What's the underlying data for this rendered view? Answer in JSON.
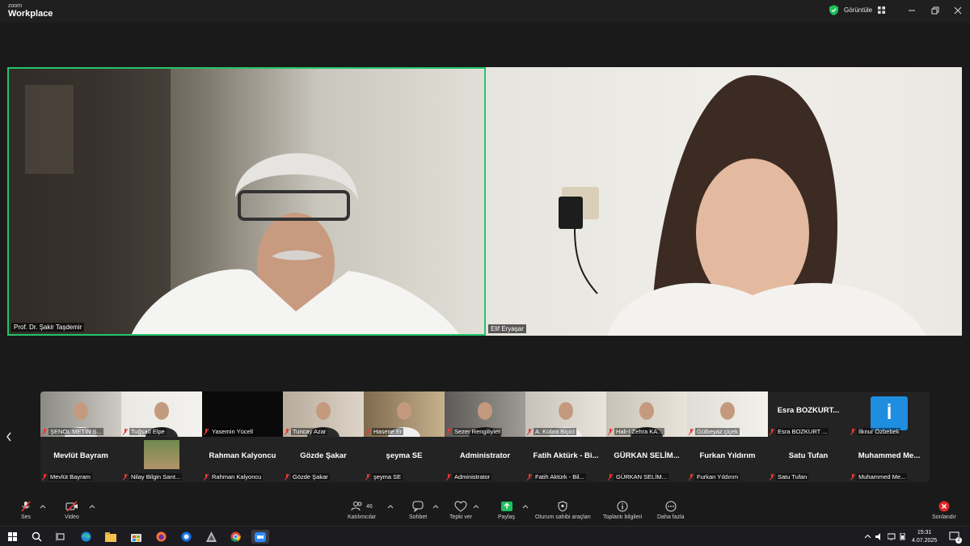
{
  "app": {
    "brand_small": "zoom",
    "brand_big": "Workplace"
  },
  "titlebar": {
    "view_label": "Görüntüle"
  },
  "main_videos": [
    {
      "name": "Prof. Dr. Şakir Taşdemir"
    },
    {
      "name": "Elif Eryaşar"
    }
  ],
  "gallery": {
    "row1": [
      {
        "label": "ŞENOL METİN S...",
        "type": "video"
      },
      {
        "label": "Tuğşad Elpe",
        "type": "video"
      },
      {
        "label": "Yasemin Yücell",
        "type": "black"
      },
      {
        "label": "Tuncay Azar",
        "type": "video"
      },
      {
        "label": "Hasene Er",
        "type": "video"
      },
      {
        "label": "Sezer Rengiliyler",
        "type": "video"
      },
      {
        "label": "A. Kübra Biçici",
        "type": "video"
      },
      {
        "label": "Hali-I Zehra KA...",
        "type": "video"
      },
      {
        "label": "Gülbeyaz çiçek",
        "type": "video"
      },
      {
        "label": "Esra BOZKURT ...",
        "type": "name",
        "display": "Esra BOZKURT..."
      },
      {
        "label": "İlknur Özbebek",
        "type": "avatar",
        "avatar_letter": "İ"
      }
    ],
    "row2": [
      {
        "label": "Mevlüt Bayram",
        "type": "name",
        "display": "Mevlüt Bayram"
      },
      {
        "label": "Nilay Bilgin Sarıt...",
        "type": "smallvideo"
      },
      {
        "label": "Rahman Kalyoncu",
        "type": "name",
        "display": "Rahman Kalyoncu"
      },
      {
        "label": "Gözde Şakar",
        "type": "name",
        "display": "Gözde Şakar"
      },
      {
        "label": "şeyma SE",
        "type": "name",
        "display": "şeyma SE"
      },
      {
        "label": "Administrator",
        "type": "name",
        "display": "Administrator"
      },
      {
        "label": "Fatih Aktürk - Bil...",
        "type": "name",
        "display": "Fatih Aktürk - Bi..."
      },
      {
        "label": "GÜRKAN SELİM...",
        "type": "name",
        "display": "GÜRKAN SELİM..."
      },
      {
        "label": "Furkan Yıldırım",
        "type": "name",
        "display": "Furkan Yıldırım"
      },
      {
        "label": "Satu Tufan",
        "type": "name",
        "display": "Satu Tufan"
      },
      {
        "label": "Muhammed Me...",
        "type": "name",
        "display": "Muhammed  Me..."
      }
    ]
  },
  "toolbar": {
    "audio": "Ses",
    "video": "Video",
    "participants": "Katılımcılar",
    "participants_count": "46",
    "chat": "Sohbet",
    "react": "Tepki ver",
    "share": "Paylaş",
    "host_tools": "Oturum sahibi araçları",
    "meeting_info": "Toplantı bilgileri",
    "more": "Daha fazla",
    "end": "Sonlandır"
  },
  "taskbar": {
    "time": "15:31",
    "date": "4.07.2025",
    "notif_count": "2"
  },
  "colors": {
    "active_speaker": "#22c56a",
    "share_green": "#1fbf5e",
    "end_red": "#e02828",
    "muted_red": "#e53935"
  }
}
